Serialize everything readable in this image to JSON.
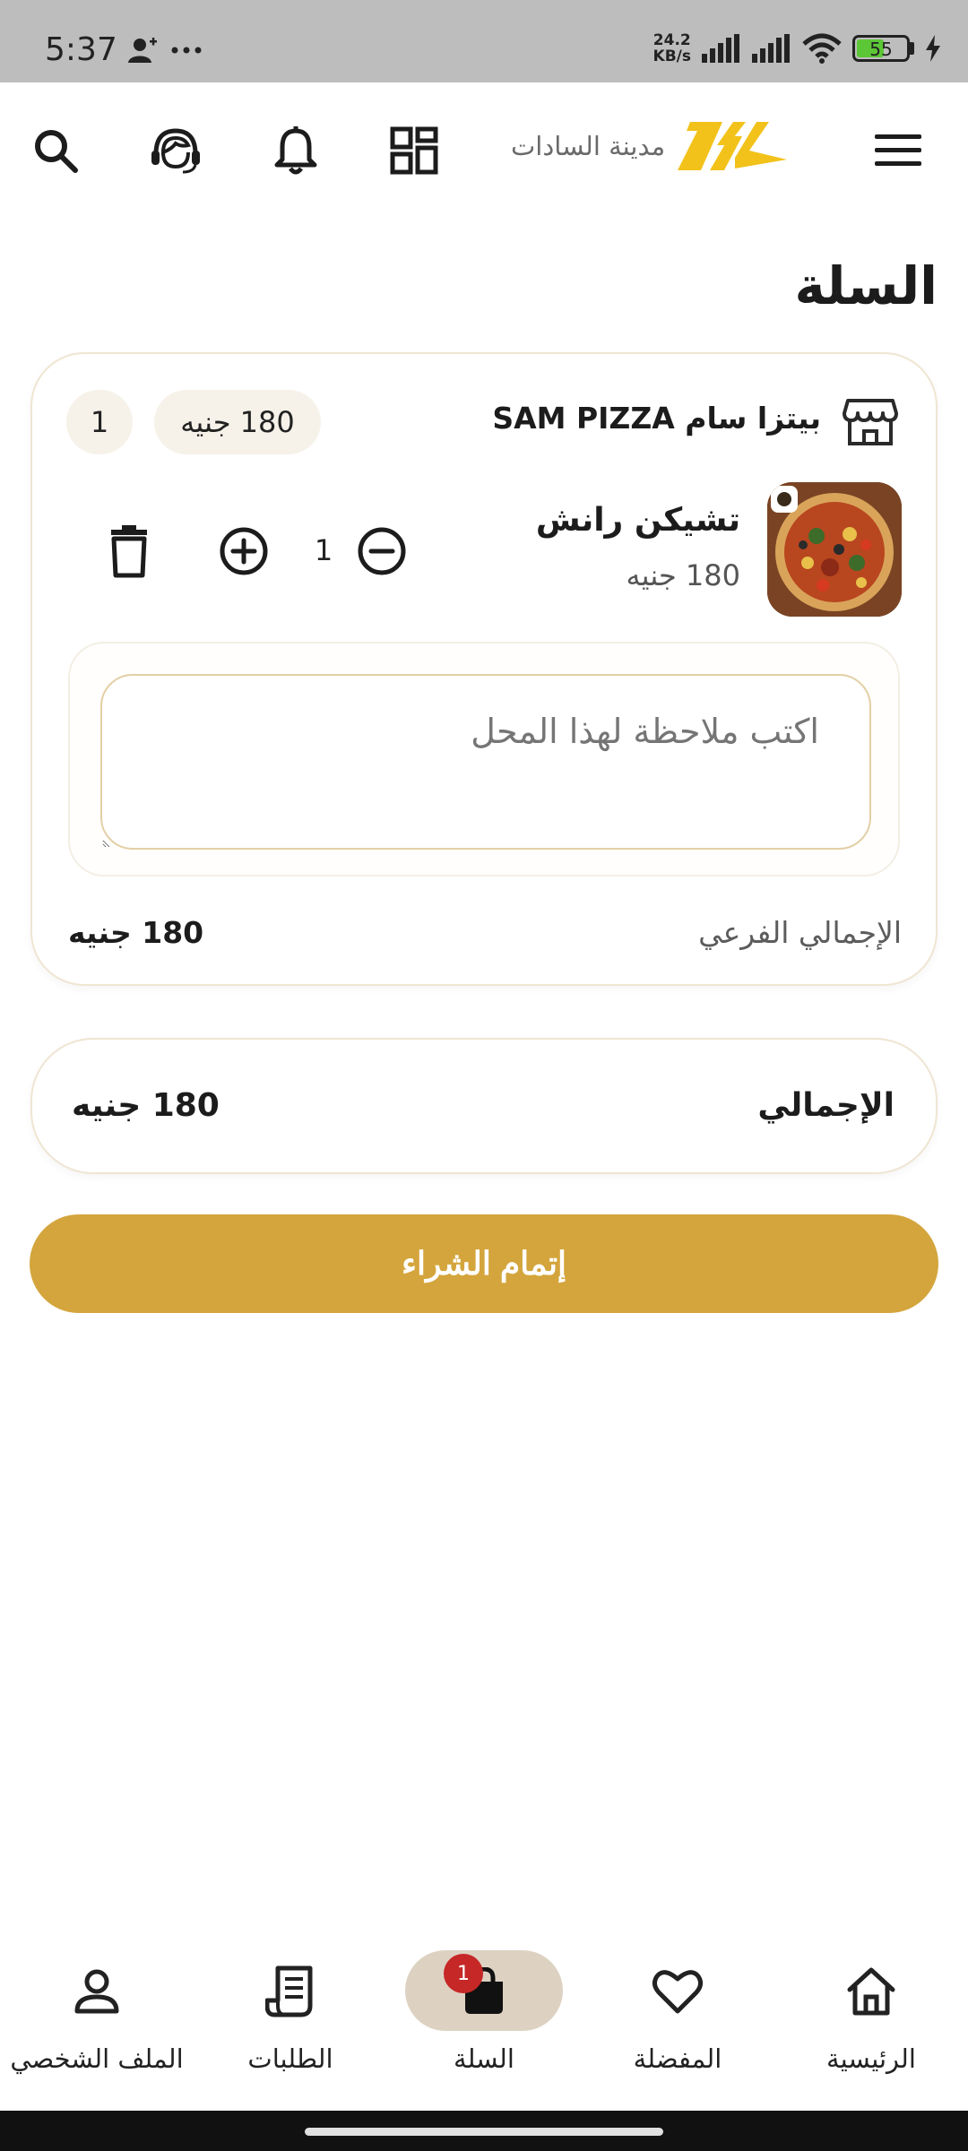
{
  "status_bar": {
    "time": "5:37",
    "network_speed_value": "24.2",
    "network_speed_unit": "KB/s",
    "battery_level": "55"
  },
  "header": {
    "brand_name": "مدينة السادات",
    "icons": [
      "search-icon",
      "support-headset-icon",
      "notification-bell-icon",
      "qr-code-icon",
      "menu-icon"
    ]
  },
  "page": {
    "title": "السلة"
  },
  "cart": {
    "store": {
      "name": "بيتزا سام SAM PIZZA",
      "total_price": "180 جنيه",
      "items_count": "1"
    },
    "items": [
      {
        "name": "تشيكن رانش",
        "price": "180 جنيه",
        "quantity": "1"
      }
    ],
    "note_placeholder": "اكتب ملاحظة لهذا المحل",
    "subtotal_label": "الإجمالي الفرعي",
    "subtotal_value": "180 جنيه"
  },
  "summary": {
    "total_label": "الإجمالي",
    "total_value": "180 جنيه"
  },
  "checkout_label": "إتمام الشراء",
  "bottom_nav": {
    "items": [
      {
        "label": "الملف الشخصي",
        "icon": "profile-icon"
      },
      {
        "label": "الطلبات",
        "icon": "orders-receipt-icon"
      },
      {
        "label": "السلة",
        "icon": "cart-bag-icon"
      },
      {
        "label": "المفضلة",
        "icon": "favorite-heart-icon"
      },
      {
        "label": "الرئيسية",
        "icon": "home-icon"
      }
    ],
    "cart_badge": "1",
    "active": "السلة"
  },
  "colors": {
    "accent": "#d4a53c",
    "brand_yellow": "#f2c21a",
    "badge": "#c62828",
    "active_pill": "#ddd2c2"
  }
}
